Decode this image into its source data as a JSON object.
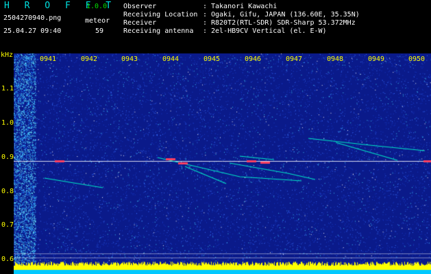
{
  "header": {
    "app_title": "H R O F F T",
    "version": "1.0.0",
    "file_name": "2504270940.png",
    "timestamp": "25.04.27 09:40",
    "meteor_label": "meteor",
    "meteor_count": "59"
  },
  "info": [
    {
      "key": "Observer",
      "sep": ":",
      "value": "Takanori Kawachi"
    },
    {
      "key": "Receiving Location",
      "sep": ":",
      "value": "Ogaki, Gifu, JAPAN (136.60E, 35.35N)"
    },
    {
      "key": "Receiver",
      "sep": ":",
      "value": "R820T2(RTL-SDR) SDR-Sharp 53.372MHz"
    },
    {
      "key": "Receiving antenna",
      "sep": ":",
      "value": "2el-HB9CV Vertical (el. E-W)"
    }
  ],
  "axis": {
    "unit": "kHz",
    "time_labels": [
      "0941",
      "0942",
      "0943",
      "0944",
      "0945",
      "0946",
      "0947",
      "0948",
      "0949",
      "0950"
    ],
    "freq_labels": [
      "1.1",
      "1.0",
      "0.9",
      "0.8",
      "0.7",
      "0.6"
    ]
  },
  "colors": {
    "background": "#0a1a8a",
    "label": "#ffff00",
    "carrier": "#ffffff",
    "echo": "#00ffcc",
    "level_bar": "#ffff00",
    "floor": "#00c8ff",
    "title": "#00e0e0"
  }
}
